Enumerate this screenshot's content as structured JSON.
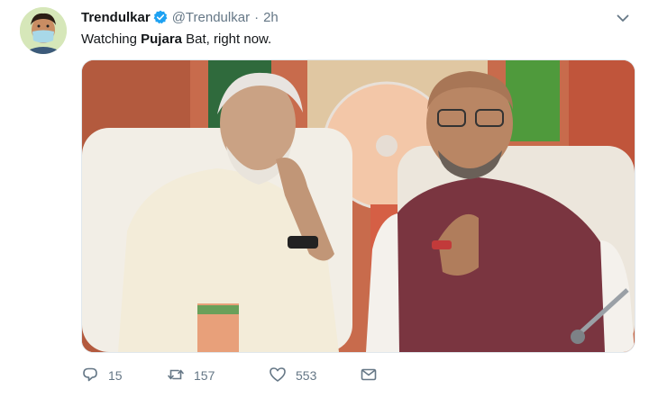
{
  "tweet": {
    "author_name": "Trendulkar",
    "handle": "@Trendulkar",
    "separator": "·",
    "time": "2h",
    "text_prefix": "Watching ",
    "text_bold": "Pujara",
    "text_suffix": " Bat, right now.",
    "verified": true
  },
  "actions": {
    "reply_count": "15",
    "retweet_count": "157",
    "like_count": "553"
  },
  "icons": {
    "verified": "verified-badge-icon",
    "caret": "chevron-down-icon",
    "reply": "reply-icon",
    "retweet": "retweet-icon",
    "like": "heart-icon",
    "dm": "envelope-icon"
  },
  "colors": {
    "verified": "#1da1f2",
    "secondary_text": "#657786",
    "primary_text": "#14171a",
    "avatar_bg": "#d6e7b9"
  }
}
